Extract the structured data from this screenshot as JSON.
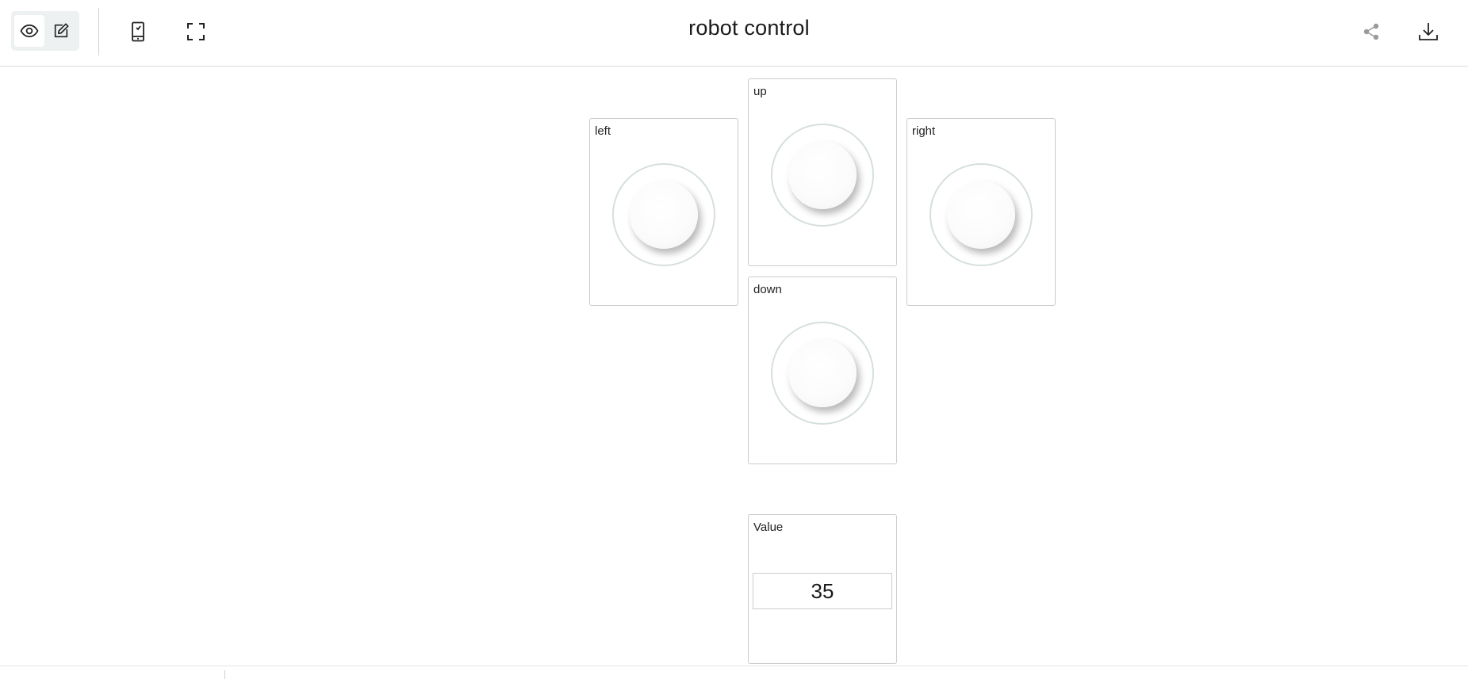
{
  "toolbar": {
    "title": "robot control",
    "icons": {
      "view": "eye-icon",
      "edit": "pencil-icon",
      "mobile": "mobile-device-icon",
      "fullscreen": "fullscreen-icon",
      "share": "share-icon",
      "download": "download-icon"
    }
  },
  "widgets": {
    "left": {
      "label": "left"
    },
    "up": {
      "label": "up"
    },
    "right": {
      "label": "right"
    },
    "down": {
      "label": "down"
    },
    "value": {
      "label": "Value",
      "value": "35"
    }
  },
  "colors": {
    "border": "#c9cccc",
    "ring": "#d6dfde",
    "mode_group_bg": "#eef1f1"
  }
}
